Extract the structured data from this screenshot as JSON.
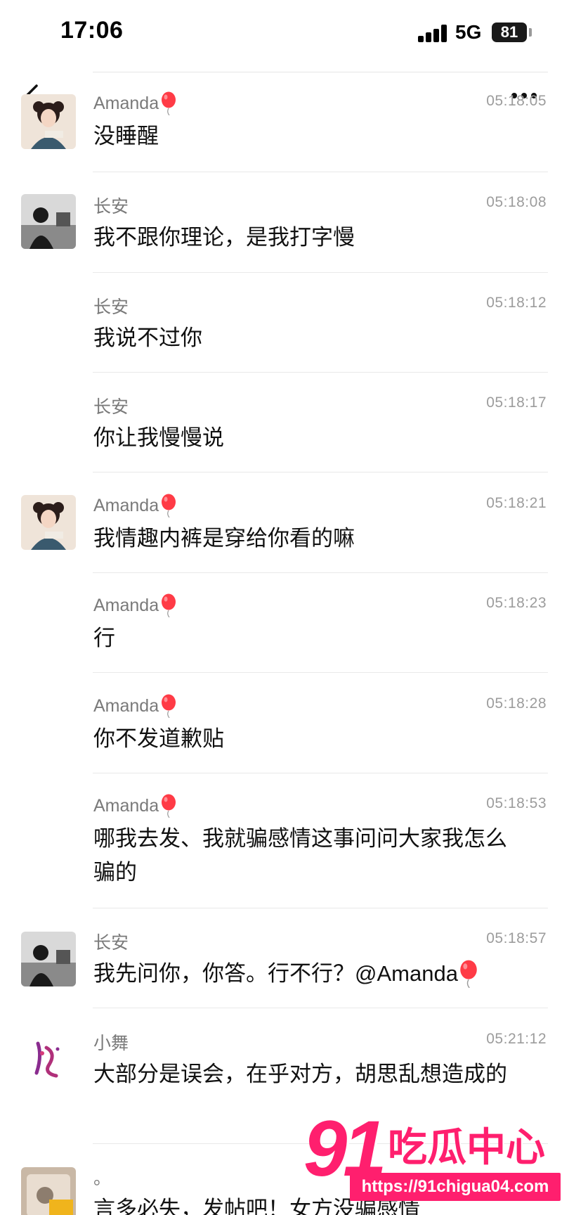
{
  "status": {
    "time": "17:06",
    "network": "5G",
    "battery": "81"
  },
  "messages": [
    {
      "sender": "Amanda",
      "balloon": true,
      "time": "05:18:05",
      "text": "没睡醒",
      "avatar": "amanda-avatar"
    },
    {
      "sender": "长安",
      "balloon": false,
      "time": "05:18:08",
      "text": "我不跟你理论，是我打字慢",
      "avatar": "changan-avatar"
    },
    {
      "sender": "长安",
      "balloon": false,
      "time": "05:18:12",
      "text": "我说不过你"
    },
    {
      "sender": "长安",
      "balloon": false,
      "time": "05:18:17",
      "text": "你让我慢慢说"
    },
    {
      "sender": "Amanda",
      "balloon": true,
      "time": "05:18:21",
      "text": "我情趣内裤是穿给你看的嘛",
      "avatar": "amanda-avatar"
    },
    {
      "sender": "Amanda",
      "balloon": true,
      "time": "05:18:23",
      "text": "行"
    },
    {
      "sender": "Amanda",
      "balloon": true,
      "time": "05:18:28",
      "text": "你不发道歉贴"
    },
    {
      "sender": "Amanda",
      "balloon": true,
      "time": "05:18:53",
      "text": "哪我去发、我就骗感情这事问问大家我怎么骗的"
    },
    {
      "sender": "长安",
      "balloon": false,
      "time": "05:18:57",
      "text": "我先问你，你答。行不行？@Amanda",
      "mention_balloon": true,
      "avatar": "changan-avatar"
    },
    {
      "sender": "小舞",
      "balloon": false,
      "time": "05:21:12",
      "text": "大部分是误会，在乎对方，胡思乱想造成的",
      "avatar": "xiaowu-avatar"
    },
    {
      "sender": "。",
      "balloon": false,
      "time": "",
      "text": "言多必失，发帖吧！女方没骗感情",
      "avatar": "dot-avatar"
    }
  ],
  "watermark": {
    "logo_number": "91",
    "logo_name": "吃瓜中心",
    "url": "https://91chigua04.com"
  },
  "colors": {
    "accent": "#ff1f6e",
    "balloon": "#ff3b46",
    "time": "#9c9c9c",
    "sender": "#7a7a7a"
  }
}
